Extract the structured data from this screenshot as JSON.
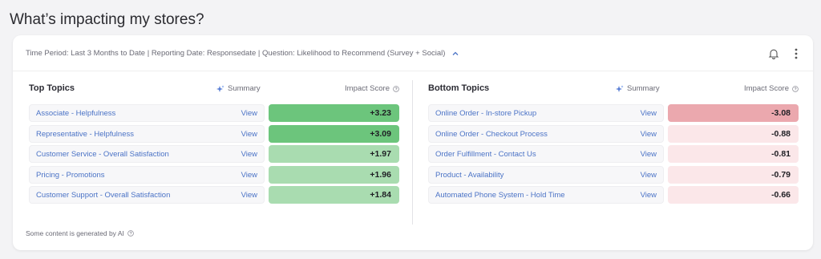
{
  "page_title": "What’s impacting my stores?",
  "filter_text": "Time Period: Last 3 Months to Date | Reporting Date: Responsedate | Question: Likelihood to Recommend (Survey + Social)",
  "top": {
    "title": "Top Topics",
    "summary_label": "Summary",
    "impact_label": "Impact Score",
    "items": [
      {
        "label": "Associate - Helpfulness",
        "view": "View",
        "score": "+3.23",
        "color": "#6cc57c"
      },
      {
        "label": "Representative - Helpfulness",
        "view": "View",
        "score": "+3.09",
        "color": "#6cc57c"
      },
      {
        "label": "Customer Service - Overall Satisfaction",
        "view": "View",
        "score": "+1.97",
        "color": "#a9dcb0"
      },
      {
        "label": "Pricing - Promotions",
        "view": "View",
        "score": "+1.96",
        "color": "#a9dcb0"
      },
      {
        "label": "Customer Support - Overall Satisfaction",
        "view": "View",
        "score": "+1.84",
        "color": "#a9dcb0"
      }
    ]
  },
  "bottom": {
    "title": "Bottom Topics",
    "summary_label": "Summary",
    "impact_label": "Impact Score",
    "items": [
      {
        "label": "Online Order - In-store Pickup",
        "view": "View",
        "score": "-3.08",
        "color": "#eba8ae"
      },
      {
        "label": "Online Order - Checkout Process",
        "view": "View",
        "score": "-0.88",
        "color": "#fbe7e9"
      },
      {
        "label": "Order Fulfillment - Contact Us",
        "view": "View",
        "score": "-0.81",
        "color": "#fbe7e9"
      },
      {
        "label": "Product - Availability",
        "view": "View",
        "score": "-0.79",
        "color": "#fbe7e9"
      },
      {
        "label": "Automated Phone System - Hold Time",
        "view": "View",
        "score": "-0.66",
        "color": "#fbe7e9"
      }
    ]
  },
  "footnote": "Some content is generated by AI"
}
